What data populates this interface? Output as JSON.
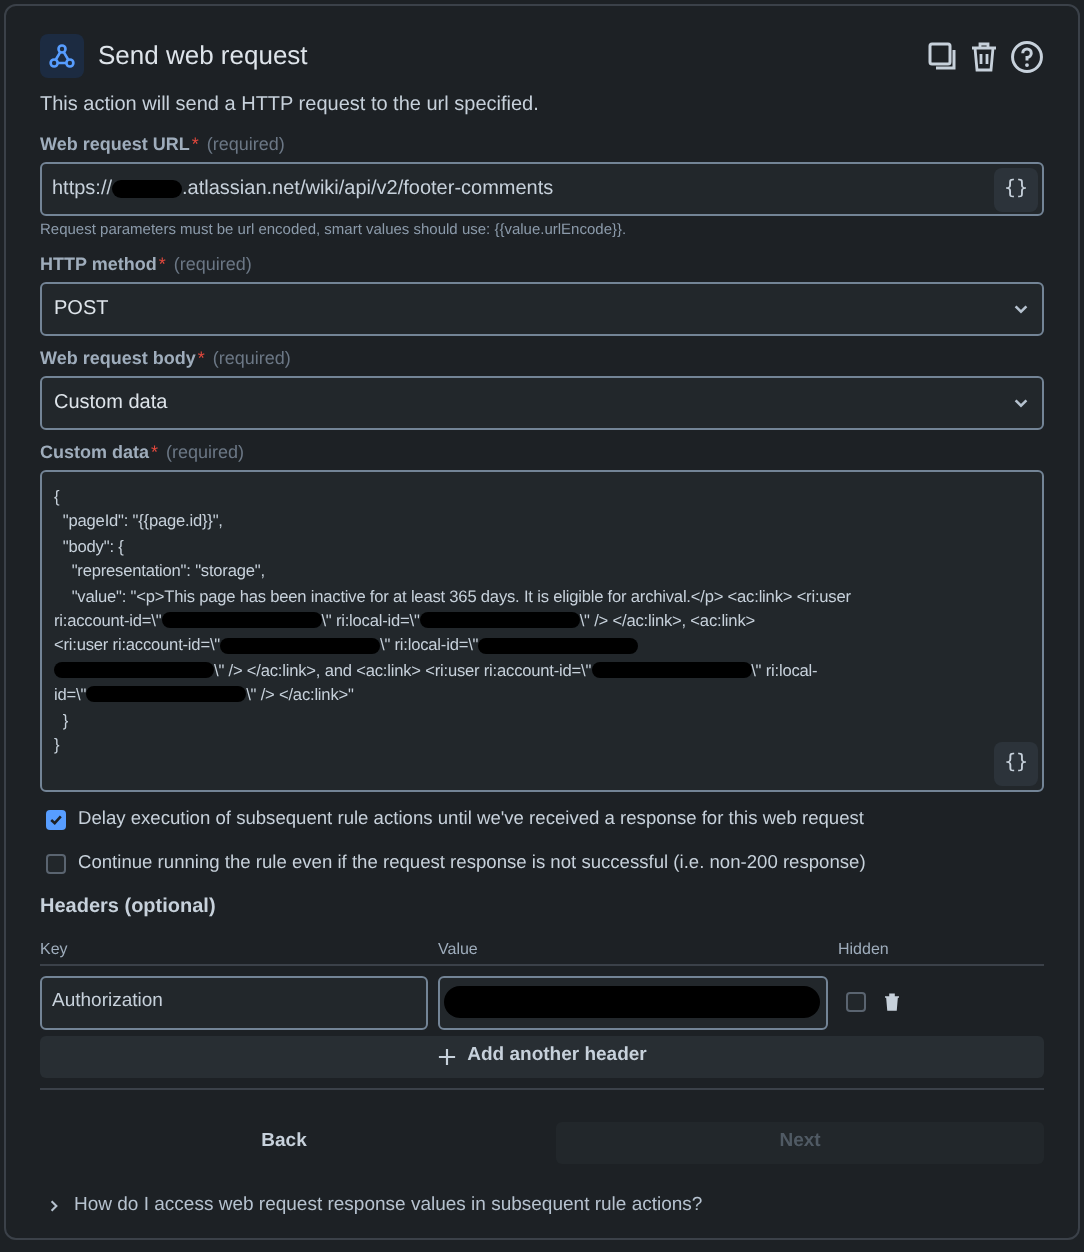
{
  "title": "Send web request",
  "description": "This action will send a HTTP request to the url specified.",
  "url_field": {
    "label": "Web request URL",
    "required_mark": "*",
    "required_note": "(required)",
    "parts": [
      {
        "kind": "text",
        "text": "https://"
      },
      {
        "kind": "redaction"
      },
      {
        "kind": "text",
        "text": ".atlassian.net/wiki/api/v2/footer-comments"
      }
    ],
    "smart_button": "{}",
    "help": "Request parameters must be url encoded, smart values should use: {{value.urlEncode}}."
  },
  "method_field": {
    "label": "HTTP method",
    "required_mark": "*",
    "required_note": "(required)",
    "value": "POST"
  },
  "body_field": {
    "label": "Web request body",
    "required_mark": "*",
    "required_note": "(required)",
    "value": "Custom data"
  },
  "custom_data": {
    "label": "Custom data",
    "required_mark": "*",
    "required_note": "(required)",
    "smart_button": "{}",
    "lines": [
      [
        {
          "kind": "text",
          "text": "{"
        }
      ],
      [
        {
          "kind": "text",
          "text": "  \"pageId\": \"{{page.id}}\","
        }
      ],
      [
        {
          "kind": "text",
          "text": "  \"body\": {"
        }
      ],
      [
        {
          "kind": "text",
          "text": "    \"representation\": \"storage\","
        }
      ],
      [
        {
          "kind": "text",
          "text": "    \"value\": \"<p>This page has been inactive for at least 365 days. It is eligible for archival.</p> <ac:link> <ri:user"
        }
      ],
      [
        {
          "kind": "text",
          "text": "ri:account-id=\\\""
        },
        {
          "kind": "redaction"
        },
        {
          "kind": "text",
          "text": "\\\" ri:local-id=\\\""
        },
        {
          "kind": "redaction"
        },
        {
          "kind": "text",
          "text": "\\\" /> </ac:link>, <ac:link>"
        }
      ],
      [
        {
          "kind": "text",
          "text": "<ri:user ri:account-id=\\\""
        },
        {
          "kind": "redaction"
        },
        {
          "kind": "text",
          "text": "\\\" ri:local-id=\\\""
        },
        {
          "kind": "redaction"
        }
      ],
      [
        {
          "kind": "redaction"
        },
        {
          "kind": "text",
          "text": "\\\" /> </ac:link>, and <ac:link> <ri:user ri:account-id=\\\""
        },
        {
          "kind": "redaction"
        },
        {
          "kind": "text",
          "text": "\\\" ri:local-"
        }
      ],
      [
        {
          "kind": "text",
          "text": "id=\\\""
        },
        {
          "kind": "redaction"
        },
        {
          "kind": "text",
          "text": "\\\" /> </ac:link>\""
        }
      ],
      [
        {
          "kind": "text",
          "text": "  }"
        }
      ],
      [
        {
          "kind": "text",
          "text": "}"
        }
      ]
    ]
  },
  "options": [
    {
      "label": "Delay execution of subsequent rule actions until we've received a response for this web request",
      "checked": true
    },
    {
      "label": "Continue running the rule even if the request response is not successful (i.e. non-200 response)",
      "checked": false
    }
  ],
  "headers": {
    "title": "Headers (optional)",
    "columns": [
      "Key",
      "Value",
      "Hidden"
    ],
    "rows": [
      {
        "key": "Authorization",
        "value_redacted": true,
        "hidden": false
      }
    ],
    "add_button": "Add another header"
  },
  "footer": {
    "back": "Back",
    "next": "Next",
    "next_disabled": true
  },
  "help_link": "How do I access web request response values in subsequent rule actions?"
}
